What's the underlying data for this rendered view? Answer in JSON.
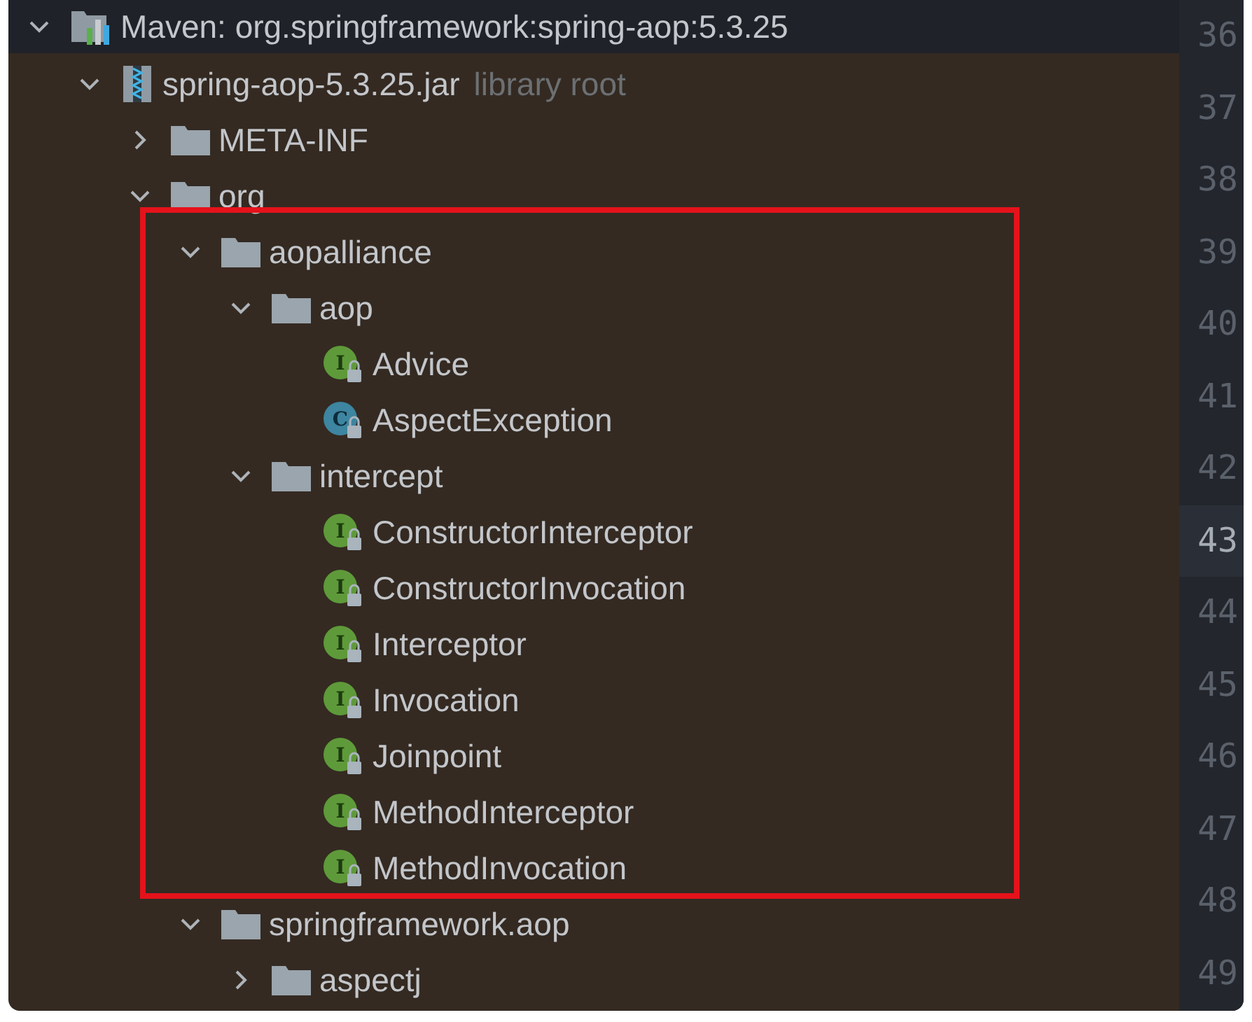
{
  "tree": [
    {
      "kind": "maven",
      "label": "Maven: org.springframework:spring-aop:5.3.25",
      "expanded": true,
      "children": [
        {
          "kind": "jar",
          "label": "spring-aop-5.3.25.jar",
          "hint": "library root",
          "expanded": true,
          "children": [
            {
              "kind": "folder",
              "label": "META-INF",
              "expanded": false
            },
            {
              "kind": "folder",
              "label": "org",
              "expanded": true,
              "children": [
                {
                  "kind": "folder",
                  "label": "aopalliance",
                  "expanded": true,
                  "children": [
                    {
                      "kind": "folder",
                      "label": "aop",
                      "expanded": true,
                      "children": [
                        {
                          "kind": "interface",
                          "letter": "I",
                          "label": "Advice"
                        },
                        {
                          "kind": "class",
                          "letter": "C",
                          "label": "AspectException"
                        }
                      ]
                    },
                    {
                      "kind": "folder",
                      "label": "intercept",
                      "expanded": true,
                      "children": [
                        {
                          "kind": "interface",
                          "letter": "I",
                          "label": "ConstructorInterceptor"
                        },
                        {
                          "kind": "interface",
                          "letter": "I",
                          "label": "ConstructorInvocation"
                        },
                        {
                          "kind": "interface",
                          "letter": "I",
                          "label": "Interceptor"
                        },
                        {
                          "kind": "interface",
                          "letter": "I",
                          "label": "Invocation"
                        },
                        {
                          "kind": "interface",
                          "letter": "I",
                          "label": "Joinpoint"
                        },
                        {
                          "kind": "interface",
                          "letter": "I",
                          "label": "MethodInterceptor"
                        },
                        {
                          "kind": "interface",
                          "letter": "I",
                          "label": "MethodInvocation"
                        }
                      ]
                    }
                  ]
                },
                {
                  "kind": "folder",
                  "label": "springframework.aop",
                  "expanded": true,
                  "children": [
                    {
                      "kind": "folder",
                      "label": "aspectj",
                      "expanded": false
                    }
                  ]
                }
              ]
            }
          ]
        }
      ]
    }
  ],
  "annotation": {
    "kind": "rectangle",
    "color": "#e5121b"
  },
  "gutter": [
    {
      "number": "36",
      "current": false
    },
    {
      "number": "37",
      "current": false
    },
    {
      "number": "38",
      "current": false
    },
    {
      "number": "39",
      "current": false
    },
    {
      "number": "40",
      "current": false
    },
    {
      "number": "41",
      "current": false
    },
    {
      "number": "42",
      "current": false
    },
    {
      "number": "43",
      "current": true
    },
    {
      "number": "44",
      "current": false
    },
    {
      "number": "45",
      "current": false
    },
    {
      "number": "46",
      "current": false
    },
    {
      "number": "47",
      "current": false
    },
    {
      "number": "48",
      "current": false
    },
    {
      "number": "49",
      "current": false
    }
  ]
}
